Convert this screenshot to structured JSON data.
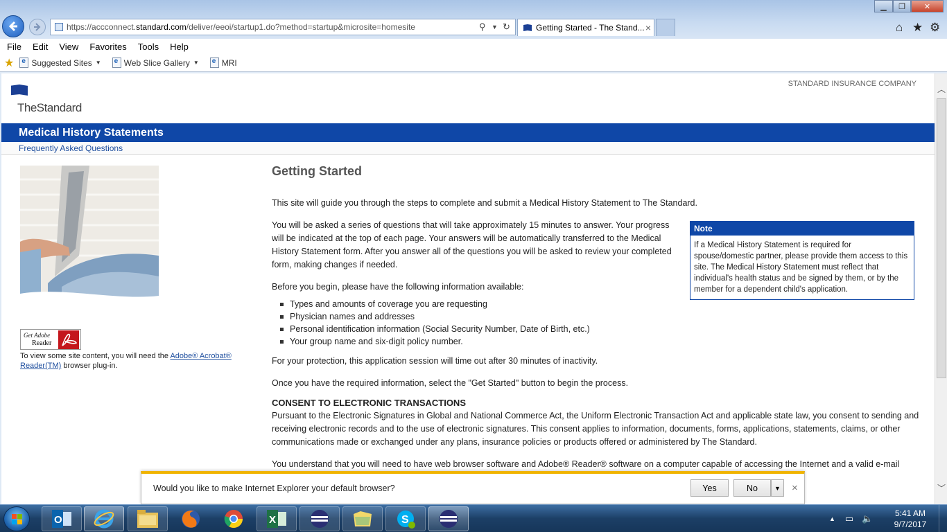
{
  "browser": {
    "url_prefix": "https://accconnect.",
    "url_domain": "standard.com",
    "url_suffix": "/deliver/eeoi/startup1.do?method=startup&microsite=homesite",
    "tab_title": "Getting Started - The Stand...",
    "menu": [
      "File",
      "Edit",
      "View",
      "Favorites",
      "Tools",
      "Help"
    ],
    "favorites": [
      {
        "label": "Suggested Sites",
        "has_dropdown": true
      },
      {
        "label": "Web Slice Gallery",
        "has_dropdown": true
      },
      {
        "label": "MRI",
        "has_dropdown": false
      }
    ]
  },
  "page": {
    "logo_text": "TheStandard",
    "company_name": "STANDARD INSURANCE COMPANY",
    "heading": "Medical History Statements",
    "faq_link": "Frequently Asked Questions",
    "adobe": {
      "get": "Get Adobe",
      "reader": "Reader",
      "note_prefix": "To view some site content, you will need the ",
      "note_link": "Adobe® Acrobat® Reader(TM)",
      "note_suffix": " browser plug-in."
    },
    "getting_started": {
      "title": "Getting Started",
      "intro": "This site will guide you through the steps to complete and submit a Medical History Statement to The Standard.",
      "para2": "You will be asked a series of questions that will take approximately 15 minutes to answer. Your progress will be indicated at the top of each page. Your answers will be automatically transferred to the Medical History Statement form. After you answer all of the questions you will be asked to review your completed form, making changes if needed.",
      "before": "Before you begin, please have the following information available:",
      "list": [
        "Types and amounts of coverage you are requesting",
        "Physician names and addresses",
        "Personal identification information (Social Security Number, Date of Birth, etc.)",
        "Your group name and six-digit policy number."
      ],
      "timeout": "For your protection, this application session will time out after 30 minutes of inactivity.",
      "once": "Once you have the required information, select the \"Get Started\" button to begin the process.",
      "consent_heading": "CONSENT TO ELECTRONIC TRANSACTIONS",
      "consent_text": "Pursuant to the Electronic Signatures in Global and National Commerce Act, the Uniform Electronic Transaction Act and applicable state law, you consent to sending and receiving electronic records and to the use of electronic signatures. This consent applies to information, documents, forms, applications, statements, claims, or other communications made or exchanged under any plans, insurance policies or products offered or administered by The Standard.",
      "understand_text": "You understand that you will need to have web browser software and Adobe® Reader® software on a computer capable of accessing the Internet and a valid e-mail address. You may request paper copies of documents at any time and withdraw your consent to receive communications at"
    },
    "note": {
      "title": "Note",
      "body": "If a Medical History Statement is required for spouse/domestic partner, please provide them access to this site. The Medical History Statement must reflect that individual's health status and be signed by them, or by the member for a dependent child's application."
    }
  },
  "notification": {
    "message": "Would you like to make Internet Explorer your default browser?",
    "yes": "Yes",
    "no": "No"
  },
  "taskbar": {
    "apps": [
      "outlook-icon",
      "internet-explorer-icon",
      "file-explorer-icon",
      "firefox-icon",
      "chrome-icon",
      "excel-icon",
      "app-icon",
      "folder-icon",
      "skype-icon",
      "app-icon"
    ],
    "time": "5:41 AM",
    "date": "9/7/2017"
  },
  "colors": {
    "brand_blue": "#0f47a7",
    "notify_accent": "#f0b400"
  }
}
